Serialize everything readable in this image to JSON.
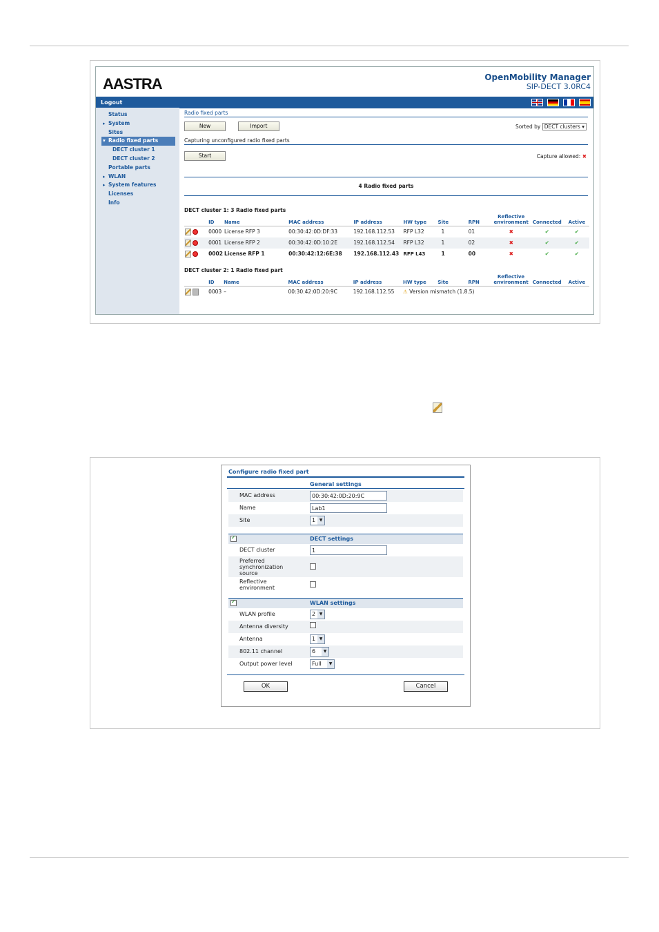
{
  "app": {
    "logo": "AASTRA",
    "product_name": "OpenMobility Manager",
    "product_version": "SIP-DECT 3.0RC4",
    "logout": "Logout"
  },
  "sidebar": {
    "items": [
      {
        "label": "Status"
      },
      {
        "label": "System"
      },
      {
        "label": "Sites"
      },
      {
        "label": "Radio fixed parts"
      },
      {
        "label": "DECT cluster 1"
      },
      {
        "label": "DECT cluster 2"
      },
      {
        "label": "Portable parts"
      },
      {
        "label": "WLAN"
      },
      {
        "label": "System features"
      },
      {
        "label": "Licenses"
      },
      {
        "label": "Info"
      }
    ]
  },
  "rfp_page": {
    "title": "Radio fixed parts",
    "new_button": "New",
    "import_button": "Import",
    "sorted_by_label": "Sorted by",
    "sorted_by_value": "DECT clusters",
    "capture_title": "Capturing unconfigured radio fixed parts",
    "start_button": "Start",
    "capture_allowed_label": "Capture allowed:",
    "summary": "4 Radio fixed parts",
    "columns": {
      "id": "ID",
      "name": "Name",
      "mac": "MAC address",
      "ip": "IP address",
      "hw_type": "HW type",
      "site": "Site",
      "rpn": "RPN",
      "reflective": "Reflective environment",
      "connected": "Connected",
      "active": "Active"
    },
    "cluster1": {
      "title": "DECT cluster 1: 3 Radio fixed parts",
      "rows": [
        {
          "id": "0000",
          "name": "License RFP 3",
          "mac": "00:30:42:0D:DF:33",
          "ip": "192.168.112.53",
          "hw": "RFP L32",
          "site": "1",
          "rpn": "01"
        },
        {
          "id": "0001",
          "name": "License RFP 2",
          "mac": "00:30:42:0D:10:2E",
          "ip": "192.168.112.54",
          "hw": "RFP L32",
          "site": "1",
          "rpn": "02"
        },
        {
          "id": "0002",
          "name": "License RFP 1",
          "mac": "00:30:42:12:6E:38",
          "ip": "192.168.112.43",
          "hw": "RFP L43",
          "site": "1",
          "rpn": "00"
        }
      ]
    },
    "cluster2": {
      "title": "DECT cluster 2: 1 Radio fixed part",
      "rows": [
        {
          "id": "0003",
          "name": "–",
          "mac": "00:30:42:0D:20:9C",
          "ip": "192.168.112.55",
          "warning": "Version mismatch (1.8.5)"
        }
      ]
    },
    "icons": {
      "cross": "✖",
      "check": "✔",
      "warn": "⚠"
    }
  },
  "config_dialog": {
    "title": "Configure radio fixed part",
    "general_header": "General settings",
    "mac_label": "MAC address",
    "mac_value": "00:30:42:0D:20:9C",
    "name_label": "Name",
    "name_value": "Lab1",
    "site_label": "Site",
    "site_value": "1",
    "dect_header": "DECT settings",
    "dect_cluster_label": "DECT cluster",
    "dect_cluster_value": "1",
    "pref_sync_label": "Preferred synchronization source",
    "reflective_label": "Reflective environment",
    "wlan_header": "WLAN settings",
    "wlan_profile_label": "WLAN profile",
    "wlan_profile_value": "2",
    "antenna_diversity_label": "Antenna diversity",
    "antenna_label": "Antenna",
    "antenna_value": "1",
    "channel_label": "802.11 channel",
    "channel_value": "6",
    "power_label": "Output power level",
    "power_value": "Full",
    "ok_button": "OK",
    "cancel_button": "Cancel"
  }
}
